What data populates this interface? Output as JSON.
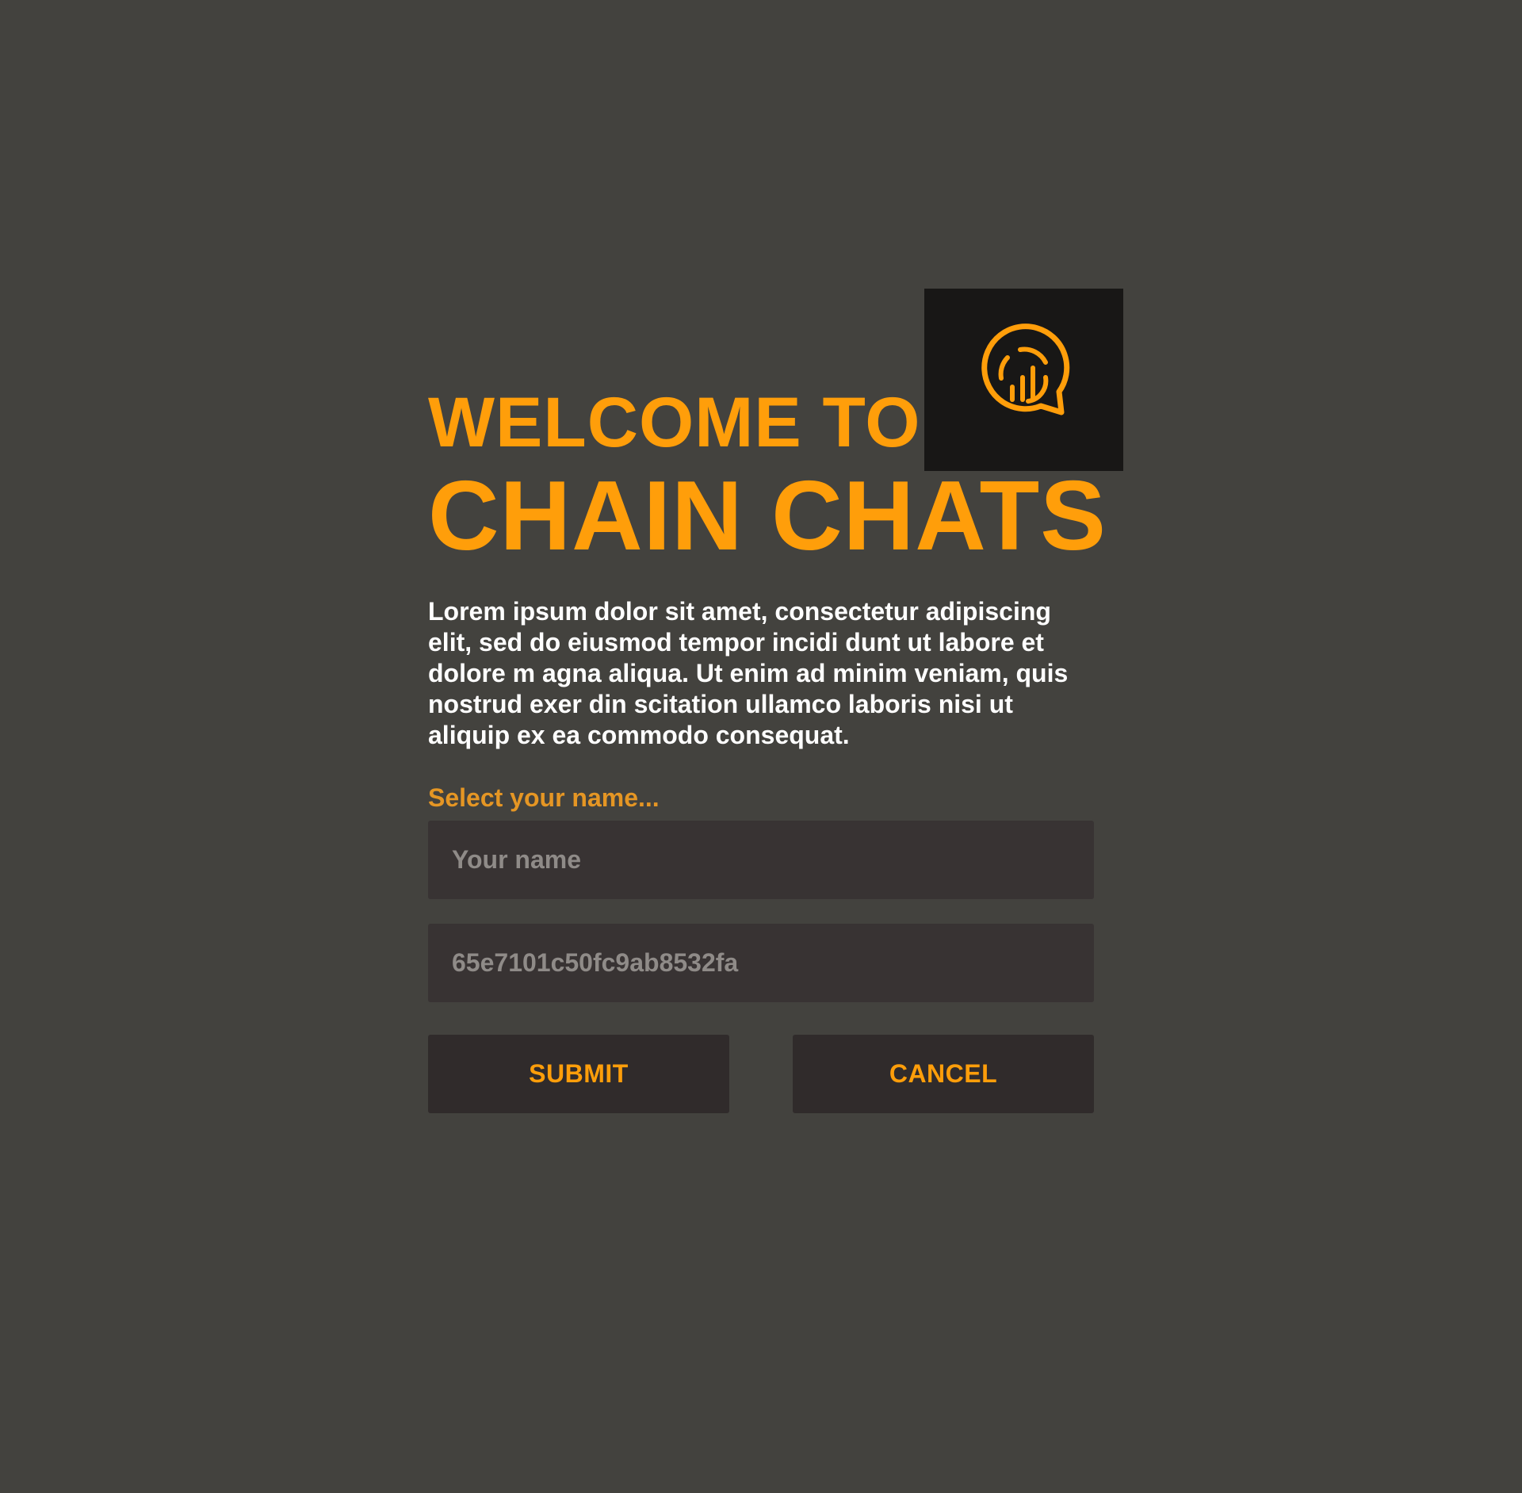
{
  "welcome": {
    "heading_line1": "WELCOME TO",
    "heading_line2": "CHAIN CHATS",
    "description": "Lorem ipsum dolor sit amet, consectetur adipiscing elit, sed do eiusmod tempor   incidi dunt ut labore et dolore m agna aliqua. Ut enim ad minim veniam, quis nostrud exer  din scitation ullamco laboris nisi ut aliquip ex ea commodo consequat.",
    "logo_icon": "chat-bubble-chart-icon"
  },
  "form": {
    "label": "Select your name...",
    "name_placeholder": "Your name",
    "id_value": "65e7101c50fc9ab8532fa",
    "submit_label": "SUBMIT",
    "cancel_label": "CANCEL"
  },
  "colors": {
    "background": "#43423e",
    "accent": "#ff9e0a",
    "logo_background": "#181716",
    "field_background": "#383333",
    "button_background": "#302b2b"
  }
}
